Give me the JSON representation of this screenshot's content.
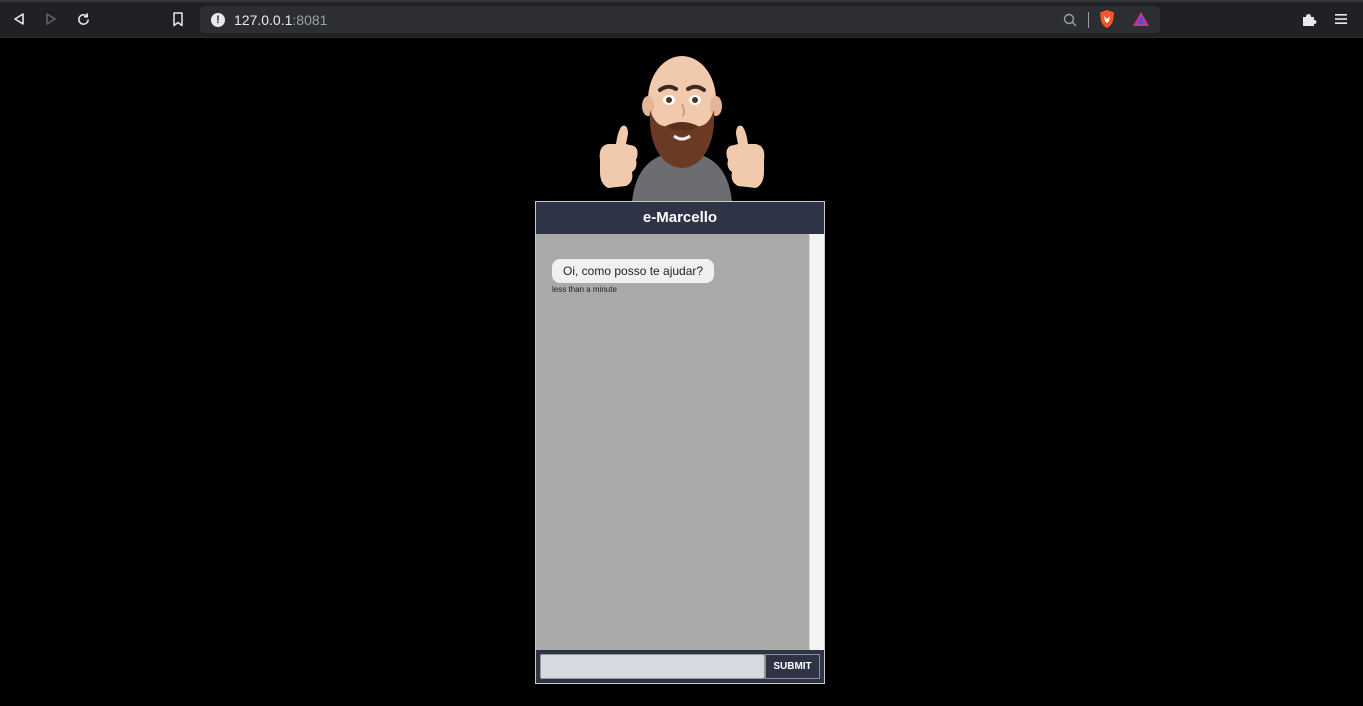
{
  "browser": {
    "url_host": "127.0.0.1",
    "url_port": ":8081",
    "nav_icons": [
      "back-icon",
      "forward-icon",
      "reload-icon",
      "bookmark-icon"
    ],
    "right_icons": [
      "zoom-icon",
      "brave-shield-icon",
      "brave-rewards-icon",
      "extensions-icon",
      "menu-icon"
    ]
  },
  "chat": {
    "title": "e-Marcello",
    "messages": [
      {
        "text": "Oi, como posso te ajudar?",
        "time": "less than a minute"
      }
    ],
    "input_value": "",
    "submit_label": "SUBMIT"
  },
  "colors": {
    "header_bg": "#2e3446",
    "body_bg": "#aaaaaa",
    "page_bg": "#000000"
  }
}
